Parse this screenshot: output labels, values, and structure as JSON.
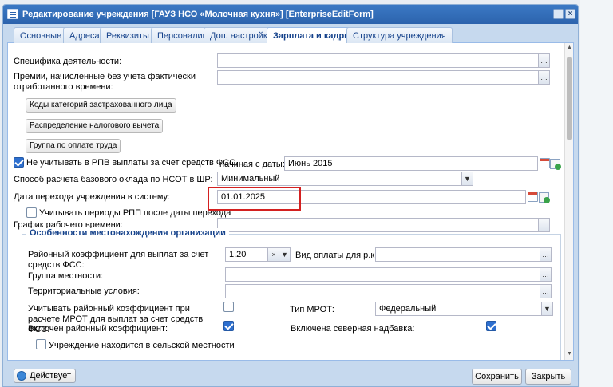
{
  "window": {
    "title": "Редактирование учреждения [ГАУЗ НСО «Молочная кухня»] [EnterpriseEditForm]"
  },
  "tabs": [
    {
      "label": "Основные"
    },
    {
      "label": "Адреса"
    },
    {
      "label": "Реквизиты"
    },
    {
      "label": "Персоналии"
    },
    {
      "label": "Доп. настройки"
    },
    {
      "label": "Зарплата и кадры",
      "active": true
    },
    {
      "label": "Структура учреждения"
    }
  ],
  "form": {
    "specifika_label": "Специфика деятельности:",
    "specifika_value": "",
    "premii_label": "Премии, начисленные без учета фактически отработанного времени:",
    "premii_value": "",
    "btn_kody": "Коды категорий застрахованного лица",
    "btn_raspredelenie": "Распределение налогового вычета",
    "btn_gruppa": "Группа по оплате труда",
    "fss_label": "Не учитывать в РПВ выплаты за счет средств ФСС,",
    "fss_checked": true,
    "nachinaya_label": "начиная с даты:",
    "nachinaya_value": "Июнь 2015",
    "sposob_label": "Способ расчета базового оклада по НСОТ в ШР:",
    "sposob_value": "Минимальный",
    "data_perehoda_label": "Дата перехода учреждения в систему:",
    "data_perehoda_value": "01.01.2025",
    "uchityvat_rpp_label": "Учитывать периоды РПП после даты перехода",
    "uchityvat_rpp_checked": false,
    "grafik_label": "График рабочего времени:",
    "grafik_value": ""
  },
  "location_section": {
    "legend": "Особенности местонахождения организации",
    "rayon_koef_label": "Районный коэффициент для выплат за счет средств ФСС:",
    "rayon_koef_value": "1.20",
    "vid_oplaty_label": "Вид оплаты для р.к.:",
    "vid_oplaty_value": "",
    "gruppa_mestnosti_label": "Группа местности:",
    "gruppa_mestnosti_value": "",
    "territorialnye_label": "Территориальные условия:",
    "territorialnye_value": "",
    "uchityvat_rk_label": "Учитывать районный коэффициент при расчете МРОТ для выплат за счет средств ФСС:",
    "uchityvat_rk_checked": false,
    "tip_mrot_label": "Тип МРОТ:",
    "tip_mrot_value": "Федеральный",
    "vklyuchen_rk_label": "Включен районный коэффициент:",
    "vklyuchen_rk_checked": true,
    "severnaya_label": "Включена северная надбавка:",
    "severnaya_checked": true,
    "selskaya_label": "Учреждение находится в сельской местности",
    "selskaya_checked": false
  },
  "footer": {
    "status_label": "Действует",
    "save_label": "Сохранить",
    "close_label": "Закрыть"
  },
  "icons": {
    "picker": "ellipsis-icon",
    "dropdown": "chevron-down-icon",
    "calendar": "calendar-icon",
    "add": "add-icon"
  }
}
